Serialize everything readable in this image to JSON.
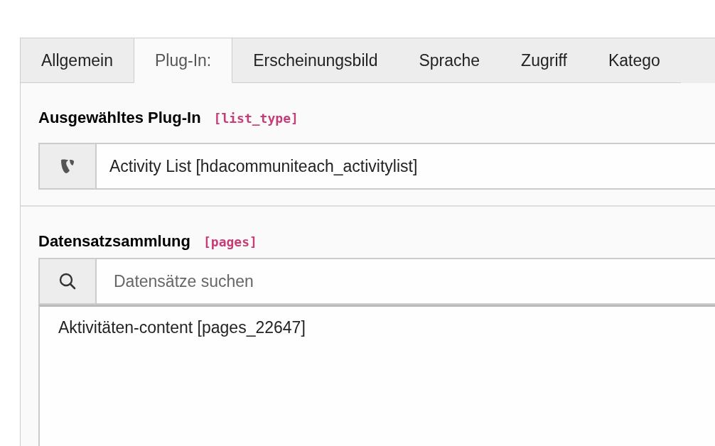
{
  "tabs": [
    {
      "label": "Allgemein",
      "selected": false
    },
    {
      "label": "Plug-In:",
      "selected": true
    },
    {
      "label": "Erscheinungsbild",
      "selected": false
    },
    {
      "label": "Sprache",
      "selected": false
    },
    {
      "label": "Zugriff",
      "selected": false
    },
    {
      "label": "Katego",
      "selected": false
    }
  ],
  "sections": [
    {
      "kind": "select",
      "title": "Ausgewähltes Plug-In",
      "field_name": "[list_type]",
      "value": "Activity List [hdacommuniteach_activitylist]"
    },
    {
      "kind": "records",
      "title": "Datensatzsammlung",
      "field_name": "[pages]",
      "search": {
        "placeholder": "Datensätze suchen"
      },
      "items": [
        "Aktivitäten-content [pages_22647]"
      ]
    }
  ]
}
